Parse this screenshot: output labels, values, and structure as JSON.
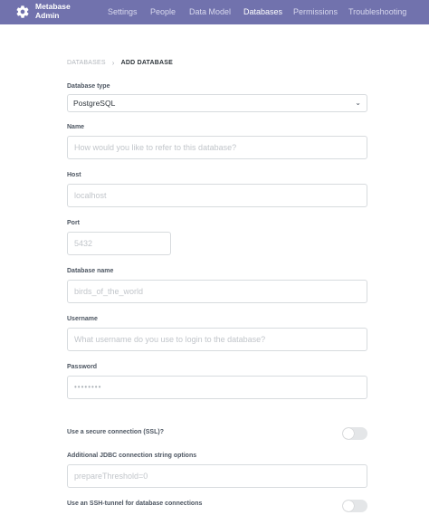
{
  "topbar": {
    "brand_line1": "Metabase",
    "brand_line2": "Admin",
    "nav": [
      "Settings",
      "People",
      "Data Model",
      "Databases",
      "Permissions",
      "Troubleshooting"
    ],
    "active_nav": "Databases",
    "bg_color": "#7172ad"
  },
  "breadcrumb": {
    "parent": "DATABASES",
    "separator": "›",
    "current": "ADD DATABASE"
  },
  "form": {
    "database_type": {
      "label": "Database type",
      "value": "PostgreSQL"
    },
    "name": {
      "label": "Name",
      "placeholder": "How would you like to refer to this database?"
    },
    "host": {
      "label": "Host",
      "placeholder": "localhost"
    },
    "port": {
      "label": "Port",
      "placeholder": "5432"
    },
    "database_name": {
      "label": "Database name",
      "placeholder": "birds_of_the_world"
    },
    "username": {
      "label": "Username",
      "placeholder": "What username do you use to login to the database?"
    },
    "password": {
      "label": "Password",
      "placeholder": "••••••••"
    },
    "ssl": {
      "label": "Use a secure connection (SSL)?",
      "enabled": false
    },
    "jdbc": {
      "label": "Additional JDBC connection string options",
      "placeholder": "prepareThreshold=0"
    },
    "ssh": {
      "label": "Use an SSH-tunnel for database connections",
      "enabled": false
    }
  }
}
